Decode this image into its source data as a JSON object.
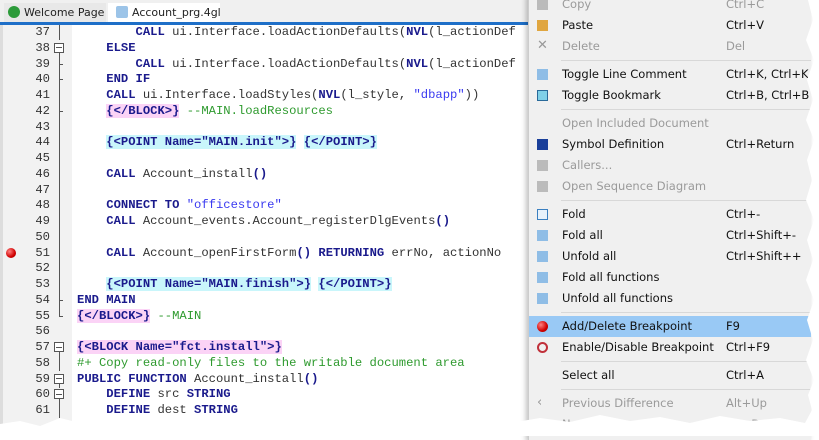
{
  "tabs": [
    {
      "label": "Welcome Page",
      "icon": "home-icon"
    },
    {
      "label": "Account_prg.4gl",
      "icon": "4gl-file-icon"
    }
  ],
  "breakpoint_line": 51,
  "lines": [
    {
      "n": "37",
      "fold": "line",
      "segs": [
        [
          "t",
          "        "
        ],
        [
          "k",
          "CALL"
        ],
        [
          "t",
          " ui.Interface.loadActionDefaults("
        ],
        [
          "k",
          "NVL"
        ],
        [
          "t",
          "(l_actionDef"
        ]
      ]
    },
    {
      "n": "38",
      "fold": "box",
      "segs": [
        [
          "t",
          "    "
        ],
        [
          "k",
          "ELSE"
        ]
      ]
    },
    {
      "n": "39",
      "fold": "tick",
      "segs": [
        [
          "t",
          "        "
        ],
        [
          "k",
          "CALL"
        ],
        [
          "t",
          " ui.Interface.loadActionDefaults("
        ],
        [
          "k",
          "NVL"
        ],
        [
          "t",
          "(l_actionDef"
        ]
      ]
    },
    {
      "n": "40",
      "fold": "tick",
      "segs": [
        [
          "t",
          "    "
        ],
        [
          "k",
          "END IF"
        ]
      ]
    },
    {
      "n": "41",
      "fold": "line",
      "segs": [
        [
          "t",
          "    "
        ],
        [
          "k",
          "CALL"
        ],
        [
          "t",
          " ui.Interface.loadStyles("
        ],
        [
          "k",
          "NVL"
        ],
        [
          "t",
          "(l_style, "
        ],
        [
          "s",
          "\"dbapp\""
        ],
        [
          "t",
          "))"
        ]
      ]
    },
    {
      "n": "42",
      "fold": "tick",
      "segs": [
        [
          "t",
          "    "
        ],
        [
          "blk",
          "{</BLOCK>}"
        ],
        [
          "c",
          " --MAIN.loadResources"
        ]
      ]
    },
    {
      "n": "43",
      "fold": "line",
      "segs": []
    },
    {
      "n": "44",
      "fold": "line",
      "segs": [
        [
          "t",
          "    "
        ],
        [
          "pt",
          "{<POINT Name=\"MAIN.init\">}"
        ],
        [
          "t",
          " "
        ],
        [
          "pt",
          "{</POINT>}"
        ]
      ]
    },
    {
      "n": "45",
      "fold": "line",
      "segs": []
    },
    {
      "n": "46",
      "fold": "line",
      "segs": [
        [
          "t",
          "    "
        ],
        [
          "k",
          "CALL"
        ],
        [
          "t",
          " Account_install"
        ],
        [
          "k",
          "()"
        ]
      ]
    },
    {
      "n": "47",
      "fold": "line",
      "segs": []
    },
    {
      "n": "48",
      "fold": "line",
      "segs": [
        [
          "t",
          "    "
        ],
        [
          "k",
          "CONNECT TO"
        ],
        [
          "t",
          " "
        ],
        [
          "s",
          "\"officestore\""
        ]
      ]
    },
    {
      "n": "49",
      "fold": "line",
      "segs": [
        [
          "t",
          "    "
        ],
        [
          "k",
          "CALL"
        ],
        [
          "t",
          " Account_events.Account_registerDlgEvents"
        ],
        [
          "k",
          "()"
        ]
      ]
    },
    {
      "n": "50",
      "fold": "line",
      "segs": []
    },
    {
      "n": "51",
      "fold": "line",
      "segs": [
        [
          "t",
          "    "
        ],
        [
          "k",
          "CALL"
        ],
        [
          "t",
          " Account_openFirstForm"
        ],
        [
          "k",
          "() RETURNING"
        ],
        [
          "t",
          " errNo, actionNo"
        ]
      ]
    },
    {
      "n": "52",
      "fold": "line",
      "segs": []
    },
    {
      "n": "53",
      "fold": "line",
      "segs": [
        [
          "t",
          "    "
        ],
        [
          "pt",
          "{<POINT Name=\"MAIN.finish\">}"
        ],
        [
          "t",
          " "
        ],
        [
          "pt",
          "{</POINT>}"
        ]
      ]
    },
    {
      "n": "54",
      "fold": "tick",
      "segs": [
        [
          "k",
          "END MAIN"
        ]
      ]
    },
    {
      "n": "55",
      "fold": "end",
      "segs": [
        [
          "blk",
          "{</BLOCK>}"
        ],
        [
          "c",
          " --MAIN"
        ]
      ]
    },
    {
      "n": "56",
      "fold": "none",
      "segs": []
    },
    {
      "n": "57",
      "fold": "box",
      "segs": [
        [
          "blk",
          "{<BLOCK Name=\"fct.install\">}"
        ]
      ]
    },
    {
      "n": "58",
      "fold": "line",
      "segs": [
        [
          "c",
          "#+ Copy read-only files to the writable document area"
        ]
      ]
    },
    {
      "n": "59",
      "fold": "box",
      "segs": [
        [
          "k",
          "PUBLIC FUNCTION"
        ],
        [
          "t",
          " Account_install"
        ],
        [
          "k",
          "()"
        ]
      ]
    },
    {
      "n": "60",
      "fold": "box",
      "segs": [
        [
          "t",
          "    "
        ],
        [
          "k",
          "DEFINE"
        ],
        [
          "t",
          " src "
        ],
        [
          "k",
          "STRING"
        ]
      ]
    },
    {
      "n": "61",
      "fold": "line",
      "segs": [
        [
          "t",
          "    "
        ],
        [
          "k",
          "DEFINE"
        ],
        [
          "t",
          " dest "
        ],
        [
          "k",
          "STRING"
        ]
      ]
    }
  ],
  "context_menu": {
    "items": [
      {
        "label": "Copy",
        "shortcut": "Ctrl+C",
        "disabled": true,
        "icon": "copy-icon"
      },
      {
        "label": "Paste",
        "shortcut": "Ctrl+V",
        "disabled": false,
        "icon": "paste-icon"
      },
      {
        "label": "Delete",
        "shortcut": "Del",
        "disabled": true,
        "icon": "delete-icon"
      },
      {
        "sep": true
      },
      {
        "label": "Toggle Line Comment",
        "shortcut": "Ctrl+K, Ctrl+K",
        "disabled": false,
        "icon": "comment-icon"
      },
      {
        "label": "Toggle Bookmark",
        "shortcut": "Ctrl+B, Ctrl+B",
        "disabled": false,
        "icon": "bookmark-icon"
      },
      {
        "sep": true
      },
      {
        "label": "Open Included Document",
        "shortcut": "",
        "disabled": true,
        "icon": ""
      },
      {
        "label": "Symbol Definition",
        "shortcut": "Ctrl+Return",
        "disabled": false,
        "icon": "symbol-definition-icon"
      },
      {
        "label": "Callers...",
        "shortcut": "",
        "disabled": true,
        "icon": "callers-icon"
      },
      {
        "label": "Open Sequence Diagram",
        "shortcut": "",
        "disabled": true,
        "icon": "sequence-diagram-icon"
      },
      {
        "sep": true
      },
      {
        "label": "Fold",
        "shortcut": "Ctrl+-",
        "disabled": false,
        "icon": "fold-icon"
      },
      {
        "label": "Fold all",
        "shortcut": "Ctrl+Shift+-",
        "disabled": false,
        "icon": "fold-all-icon"
      },
      {
        "label": "Unfold all",
        "shortcut": "Ctrl+Shift++",
        "disabled": false,
        "icon": "unfold-all-icon"
      },
      {
        "label": "Fold all functions",
        "shortcut": "",
        "disabled": false,
        "icon": "fold-all-icon"
      },
      {
        "label": "Unfold all functions",
        "shortcut": "",
        "disabled": false,
        "icon": "unfold-all-icon"
      },
      {
        "sep": true
      },
      {
        "label": "Add/Delete Breakpoint",
        "shortcut": "F9",
        "disabled": false,
        "highlighted": true,
        "icon": "breakpoint-icon"
      },
      {
        "label": "Enable/Disable Breakpoint",
        "shortcut": "Ctrl+F9",
        "disabled": false,
        "icon": "breakpoint-outline-icon"
      },
      {
        "sep": true
      },
      {
        "label": "Select all",
        "shortcut": "Ctrl+A",
        "disabled": false,
        "icon": ""
      },
      {
        "sep": true
      },
      {
        "label": "Previous Difference",
        "shortcut": "Alt+Up",
        "disabled": true,
        "icon": "chevron-left-icon"
      },
      {
        "label": "Next Difference",
        "shortcut": "Alt+Down",
        "disabled": true,
        "icon": "chevron-right-icon"
      }
    ]
  },
  "colors": {
    "keyword": "#1a1a8c",
    "string": "#3a3af0",
    "comment": "#2e9a2e",
    "block_bg": "#fbd3f6",
    "point_bg": "#c9f6fb",
    "menu_highlight": "#99c9f5",
    "tab_accent": "#1e6fc8"
  }
}
